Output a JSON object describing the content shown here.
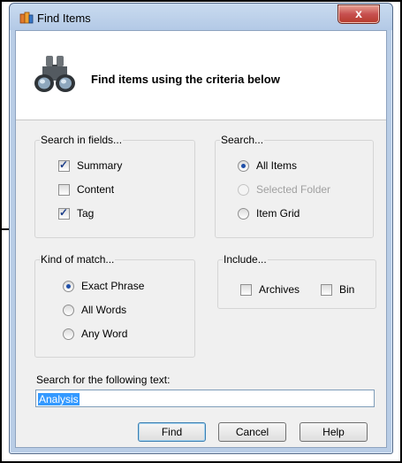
{
  "window": {
    "title": "Find Items",
    "close_glyph": "x",
    "header_text": "Find items using the criteria below"
  },
  "search_in_fields": {
    "label": "Search in fields...",
    "items": [
      {
        "label": "Summary",
        "checked": true
      },
      {
        "label": "Content",
        "checked": false
      },
      {
        "label": "Tag",
        "checked": true
      }
    ]
  },
  "search_scope": {
    "label": "Search...",
    "items": [
      {
        "label": "All Items",
        "selected": true,
        "enabled": true
      },
      {
        "label": "Selected Folder",
        "selected": false,
        "enabled": false
      },
      {
        "label": "Item Grid",
        "selected": false,
        "enabled": true
      }
    ]
  },
  "kind_of_match": {
    "label": "Kind of match...",
    "items": [
      {
        "label": "Exact Phrase",
        "selected": true
      },
      {
        "label": "All Words",
        "selected": false
      },
      {
        "label": "Any Word",
        "selected": false
      }
    ]
  },
  "include": {
    "label": "Include...",
    "items": [
      {
        "label": "Archives",
        "checked": false
      },
      {
        "label": "Bin",
        "checked": false
      }
    ]
  },
  "search_text": {
    "label": "Search for the following text:",
    "value": "Analysis"
  },
  "buttons": {
    "find": "Find",
    "cancel": "Cancel",
    "help": "Help"
  },
  "icons": {
    "app": "find-items-app-icon",
    "binoculars": "binoculars-icon",
    "close": "close-icon"
  },
  "colors": {
    "titlebar": "#b9cde6",
    "close_button": "#c75050",
    "selection": "#3399ff",
    "client_background": "#f0f0f0"
  }
}
